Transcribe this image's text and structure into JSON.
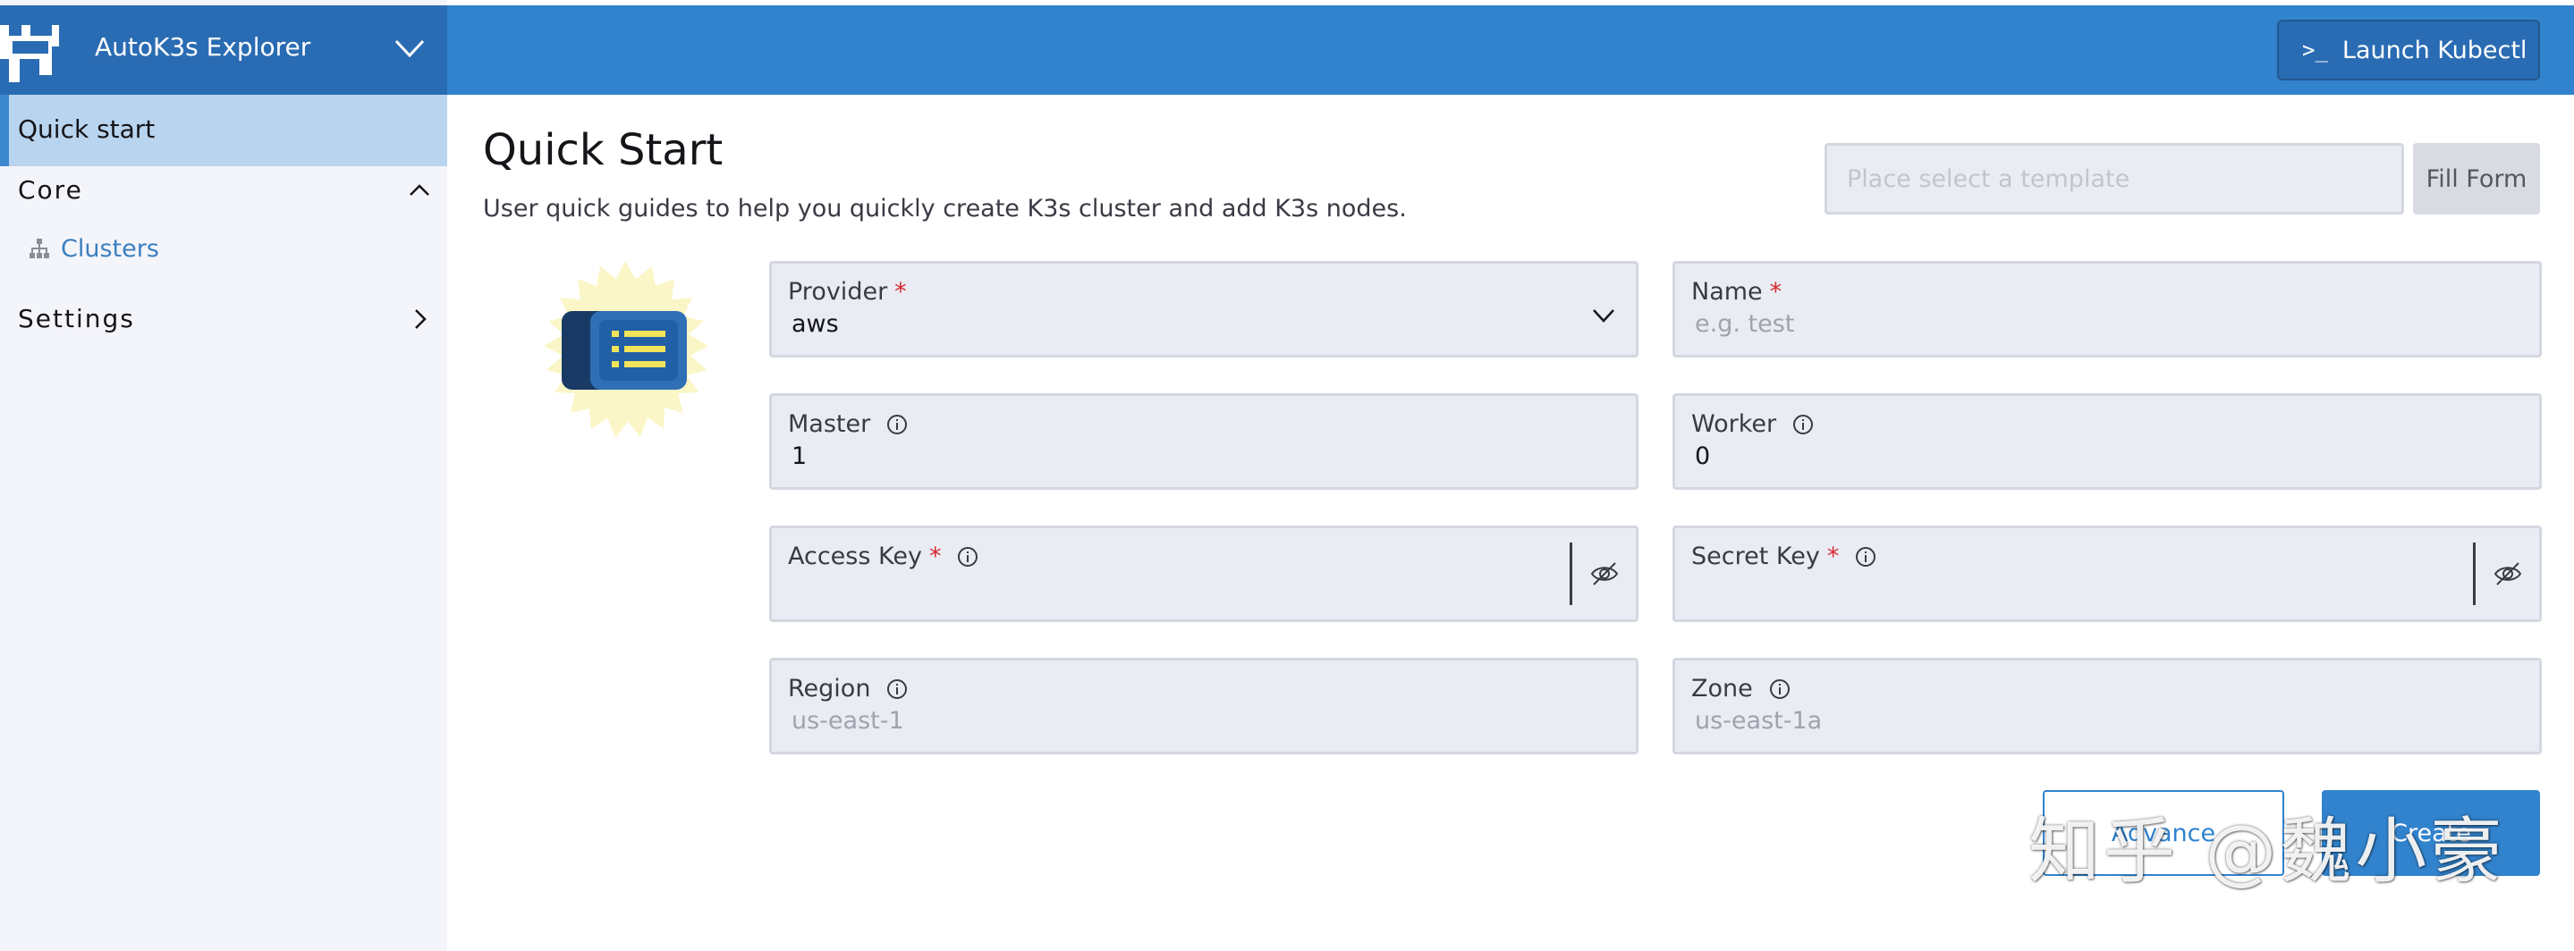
{
  "sidebar": {
    "brand_title": "AutoK3s Explorer",
    "quick_start_label": "Quick start",
    "core_label": "Core",
    "clusters_label": "Clusters",
    "settings_label": "Settings"
  },
  "header": {
    "kubectl_prompt": ">_",
    "kubectl_label": "Launch Kubectl"
  },
  "main": {
    "title": "Quick Start",
    "subtitle": "User quick guides to help you quickly create K3s cluster and add K3s nodes.",
    "template_placeholder": "Place select a template",
    "fill_form_label": "Fill Form"
  },
  "form": {
    "provider": {
      "label": "Provider",
      "required": "*",
      "value": "aws"
    },
    "name": {
      "label": "Name",
      "required": "*",
      "placeholder": "e.g. test"
    },
    "master": {
      "label": "Master",
      "value": "1"
    },
    "worker": {
      "label": "Worker",
      "value": "0"
    },
    "access_key": {
      "label": "Access Key",
      "required": "*",
      "value": ""
    },
    "secret_key": {
      "label": "Secret Key",
      "required": "*",
      "value": ""
    },
    "region": {
      "label": "Region",
      "placeholder": "us-east-1"
    },
    "zone": {
      "label": "Zone",
      "placeholder": "us-east-1a"
    }
  },
  "actions": {
    "advance_label": "Advance",
    "create_label": "Create"
  },
  "watermark": "知乎 @魏小豪",
  "colors": {
    "header_blue": "#3183cd",
    "brand_blue": "#2a6cb3",
    "sidebar_active": "#b9d4ee",
    "required_red": "#d9292c",
    "field_bg": "#eaecf4"
  },
  "icons": {
    "brand": "k3s-bull-logo-icon",
    "chevron_down": "chevron-down-icon",
    "chevron_up": "chevron-up-icon",
    "chevron_right": "chevron-right-icon",
    "clusters": "cluster-tree-icon",
    "info": "info-icon",
    "eye_off": "eye-off-icon",
    "illustration": "list-card-illustration"
  }
}
